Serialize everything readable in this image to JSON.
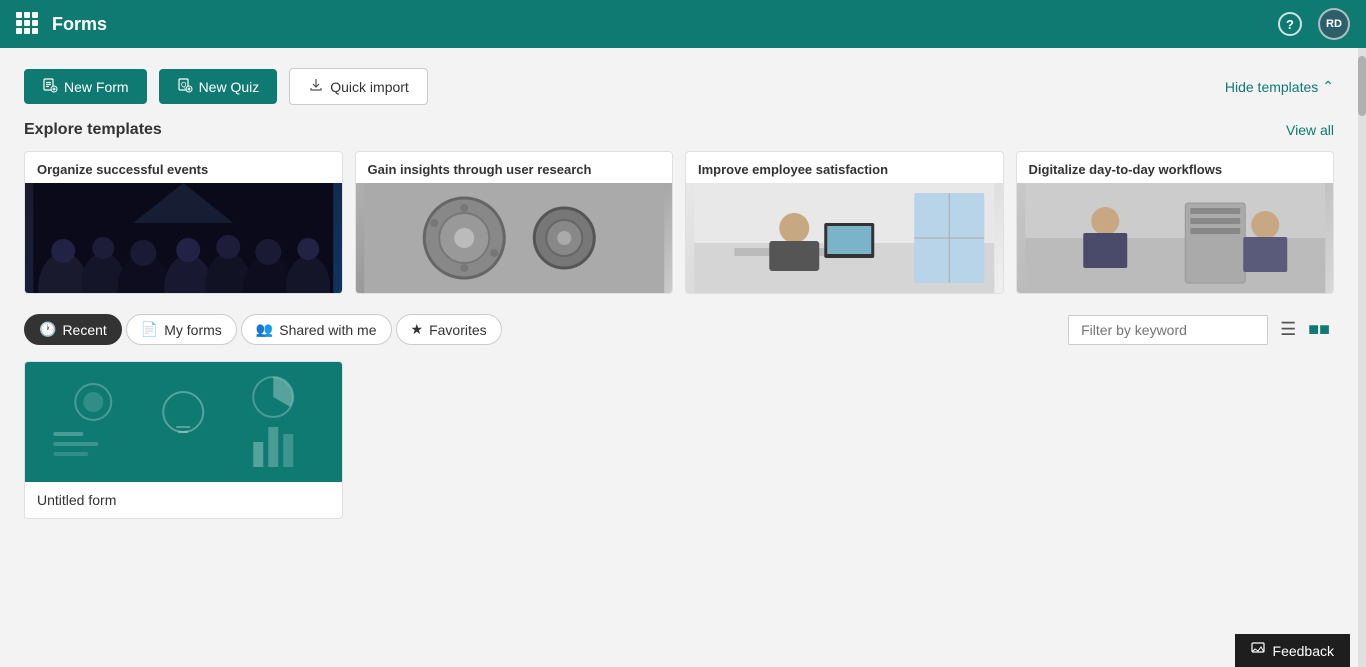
{
  "header": {
    "title": "Forms",
    "help_label": "?",
    "avatar_initials": "RD"
  },
  "toolbar": {
    "new_form_label": "New Form",
    "new_quiz_label": "New Quiz",
    "quick_import_label": "Quick import",
    "hide_templates_label": "Hide templates"
  },
  "templates_section": {
    "title": "Explore templates",
    "view_all_label": "View all",
    "cards": [
      {
        "id": "events",
        "title": "Organize successful events",
        "img_class": "img-events"
      },
      {
        "id": "research",
        "title": "Gain insights through user research",
        "img_class": "img-research"
      },
      {
        "id": "employee",
        "title": "Improve employee satisfaction",
        "img_class": "img-employee"
      },
      {
        "id": "digitalize",
        "title": "Digitalize day-to-day workflows",
        "img_class": "img-digitalize"
      }
    ]
  },
  "tabs": [
    {
      "id": "recent",
      "label": "Recent",
      "active": true
    },
    {
      "id": "my-forms",
      "label": "My forms",
      "active": false
    },
    {
      "id": "shared-with-me",
      "label": "Shared with me",
      "active": false
    },
    {
      "id": "favorites",
      "label": "Favorites",
      "active": false
    }
  ],
  "filter": {
    "placeholder": "Filter by keyword"
  },
  "forms": [
    {
      "id": "untitled-form",
      "title": "Untitled form"
    }
  ],
  "feedback": {
    "label": "Feedback"
  }
}
